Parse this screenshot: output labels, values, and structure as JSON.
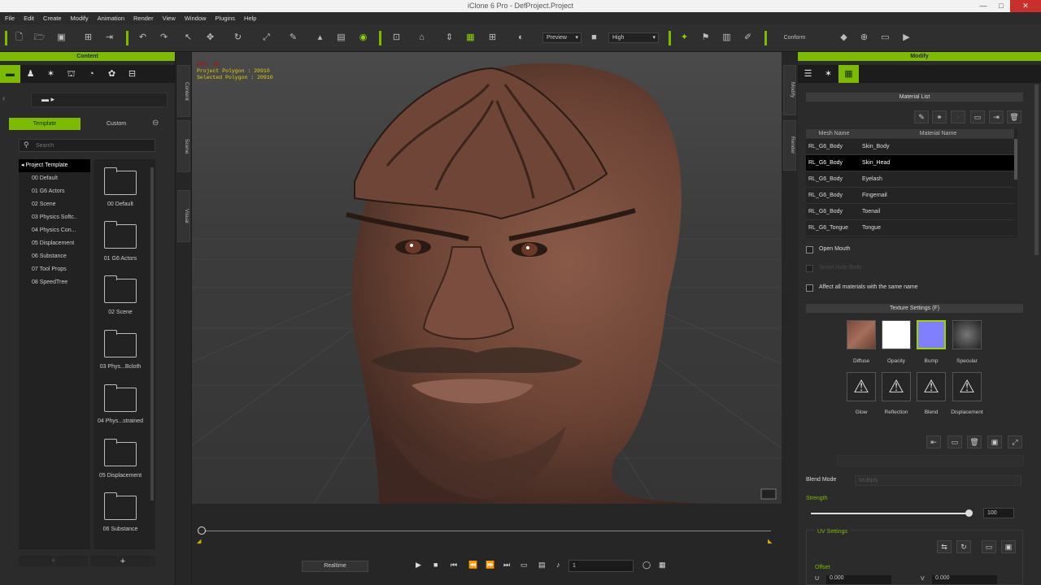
{
  "window": {
    "title": "iClone 6 Pro - DefProject.Project",
    "minimize": "—",
    "maximize": "□",
    "close": "✕"
  },
  "menu": [
    "File",
    "Edit",
    "Create",
    "Modify",
    "Animation",
    "Render",
    "View",
    "Window",
    "Plugins",
    "Help"
  ],
  "toolbar": {
    "preview_label": "Preview",
    "quality_label": "High",
    "conform_label": "Conform"
  },
  "content": {
    "header": "Content",
    "tabs": {
      "template": "Template",
      "custom": "Custom"
    },
    "search_placeholder": "Search",
    "tree": [
      "Project Template",
      "00 Default",
      "01 G6 Actors",
      "02 Scene",
      "03 Physics Softc..",
      "04 Physics Con...",
      "05 Displacement",
      "06 Substance",
      "07 Tool Props",
      "08 SpeedTree"
    ],
    "thumbs": [
      "00 Default",
      "01 G6 Actors",
      "02 Scene",
      "03 Phys...Bcloth",
      "04 Phys...strained",
      "05 Displacement",
      "06 Substance"
    ],
    "add_btn": "+",
    "side_tabs": [
      "Content",
      "Scene",
      "Visual"
    ]
  },
  "viewport": {
    "line1": "FPS: 30",
    "line2": "Project Polygon : 20910",
    "line3": "Selected Polygon : 20910"
  },
  "timeline": {
    "realtime_label": "Realtime",
    "frame_value": "1"
  },
  "modify": {
    "header": "Modify",
    "side_tabs": [
      "Modify",
      "Render"
    ],
    "material_list_header": "Material List",
    "col_mesh": "Mesh Name",
    "col_material": "Material Name",
    "rows": [
      {
        "mesh": "RL_G6_Body",
        "mat": "Skin_Body"
      },
      {
        "mesh": "RL_G6_Body",
        "mat": "Skin_Head"
      },
      {
        "mesh": "RL_G6_Body",
        "mat": "Eyelash"
      },
      {
        "mesh": "RL_G6_Body",
        "mat": "Fingernail"
      },
      {
        "mesh": "RL_G6_Body",
        "mat": "Toenail"
      },
      {
        "mesh": "RL_G6_Tongue",
        "mat": "Tongue"
      }
    ],
    "open_mouth": "Open Mouth",
    "disabled_option": "Smart Hide Body",
    "affect_all": "Affect all materials with the same name",
    "texture_header": "Texture Settings (F)",
    "textures": [
      "Diffuse",
      "Opacity",
      "Bump",
      "Specular"
    ],
    "textures2": [
      "Glow",
      "Reflection",
      "Blend",
      "Displacement"
    ],
    "blend_mode_label": "Blend Mode",
    "blend_mode_value": "Multiply",
    "strength_label": "Strength",
    "strength_value": "100",
    "strength_fraction": 0.98,
    "uv_header": "UV Settings",
    "offset_label": "Offset",
    "u_label": "U",
    "u_value": "0.000",
    "v_label": "V",
    "v_value": "0.000",
    "colors": {
      "accent": "#7dbb00",
      "selected_row": "#000000",
      "bump_swatch": "#8080ff"
    }
  }
}
